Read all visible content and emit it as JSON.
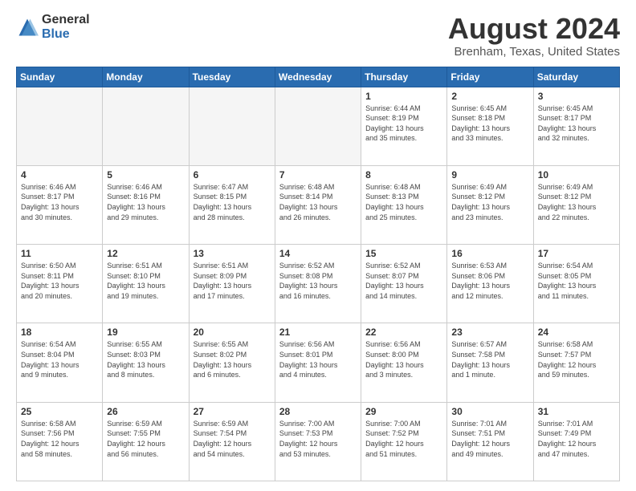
{
  "header": {
    "logo_general": "General",
    "logo_blue": "Blue",
    "title": "August 2024",
    "subtitle": "Brenham, Texas, United States"
  },
  "days_of_week": [
    "Sunday",
    "Monday",
    "Tuesday",
    "Wednesday",
    "Thursday",
    "Friday",
    "Saturday"
  ],
  "weeks": [
    [
      {
        "day": "",
        "info": "",
        "empty": true
      },
      {
        "day": "",
        "info": "",
        "empty": true
      },
      {
        "day": "",
        "info": "",
        "empty": true
      },
      {
        "day": "",
        "info": "",
        "empty": true
      },
      {
        "day": "1",
        "info": "Sunrise: 6:44 AM\nSunset: 8:19 PM\nDaylight: 13 hours\nand 35 minutes."
      },
      {
        "day": "2",
        "info": "Sunrise: 6:45 AM\nSunset: 8:18 PM\nDaylight: 13 hours\nand 33 minutes."
      },
      {
        "day": "3",
        "info": "Sunrise: 6:45 AM\nSunset: 8:17 PM\nDaylight: 13 hours\nand 32 minutes."
      }
    ],
    [
      {
        "day": "4",
        "info": "Sunrise: 6:46 AM\nSunset: 8:17 PM\nDaylight: 13 hours\nand 30 minutes."
      },
      {
        "day": "5",
        "info": "Sunrise: 6:46 AM\nSunset: 8:16 PM\nDaylight: 13 hours\nand 29 minutes."
      },
      {
        "day": "6",
        "info": "Sunrise: 6:47 AM\nSunset: 8:15 PM\nDaylight: 13 hours\nand 28 minutes."
      },
      {
        "day": "7",
        "info": "Sunrise: 6:48 AM\nSunset: 8:14 PM\nDaylight: 13 hours\nand 26 minutes."
      },
      {
        "day": "8",
        "info": "Sunrise: 6:48 AM\nSunset: 8:13 PM\nDaylight: 13 hours\nand 25 minutes."
      },
      {
        "day": "9",
        "info": "Sunrise: 6:49 AM\nSunset: 8:12 PM\nDaylight: 13 hours\nand 23 minutes."
      },
      {
        "day": "10",
        "info": "Sunrise: 6:49 AM\nSunset: 8:12 PM\nDaylight: 13 hours\nand 22 minutes."
      }
    ],
    [
      {
        "day": "11",
        "info": "Sunrise: 6:50 AM\nSunset: 8:11 PM\nDaylight: 13 hours\nand 20 minutes."
      },
      {
        "day": "12",
        "info": "Sunrise: 6:51 AM\nSunset: 8:10 PM\nDaylight: 13 hours\nand 19 minutes."
      },
      {
        "day": "13",
        "info": "Sunrise: 6:51 AM\nSunset: 8:09 PM\nDaylight: 13 hours\nand 17 minutes."
      },
      {
        "day": "14",
        "info": "Sunrise: 6:52 AM\nSunset: 8:08 PM\nDaylight: 13 hours\nand 16 minutes."
      },
      {
        "day": "15",
        "info": "Sunrise: 6:52 AM\nSunset: 8:07 PM\nDaylight: 13 hours\nand 14 minutes."
      },
      {
        "day": "16",
        "info": "Sunrise: 6:53 AM\nSunset: 8:06 PM\nDaylight: 13 hours\nand 12 minutes."
      },
      {
        "day": "17",
        "info": "Sunrise: 6:54 AM\nSunset: 8:05 PM\nDaylight: 13 hours\nand 11 minutes."
      }
    ],
    [
      {
        "day": "18",
        "info": "Sunrise: 6:54 AM\nSunset: 8:04 PM\nDaylight: 13 hours\nand 9 minutes."
      },
      {
        "day": "19",
        "info": "Sunrise: 6:55 AM\nSunset: 8:03 PM\nDaylight: 13 hours\nand 8 minutes."
      },
      {
        "day": "20",
        "info": "Sunrise: 6:55 AM\nSunset: 8:02 PM\nDaylight: 13 hours\nand 6 minutes."
      },
      {
        "day": "21",
        "info": "Sunrise: 6:56 AM\nSunset: 8:01 PM\nDaylight: 13 hours\nand 4 minutes."
      },
      {
        "day": "22",
        "info": "Sunrise: 6:56 AM\nSunset: 8:00 PM\nDaylight: 13 hours\nand 3 minutes."
      },
      {
        "day": "23",
        "info": "Sunrise: 6:57 AM\nSunset: 7:58 PM\nDaylight: 13 hours\nand 1 minute."
      },
      {
        "day": "24",
        "info": "Sunrise: 6:58 AM\nSunset: 7:57 PM\nDaylight: 12 hours\nand 59 minutes."
      }
    ],
    [
      {
        "day": "25",
        "info": "Sunrise: 6:58 AM\nSunset: 7:56 PM\nDaylight: 12 hours\nand 58 minutes."
      },
      {
        "day": "26",
        "info": "Sunrise: 6:59 AM\nSunset: 7:55 PM\nDaylight: 12 hours\nand 56 minutes."
      },
      {
        "day": "27",
        "info": "Sunrise: 6:59 AM\nSunset: 7:54 PM\nDaylight: 12 hours\nand 54 minutes."
      },
      {
        "day": "28",
        "info": "Sunrise: 7:00 AM\nSunset: 7:53 PM\nDaylight: 12 hours\nand 53 minutes."
      },
      {
        "day": "29",
        "info": "Sunrise: 7:00 AM\nSunset: 7:52 PM\nDaylight: 12 hours\nand 51 minutes."
      },
      {
        "day": "30",
        "info": "Sunrise: 7:01 AM\nSunset: 7:51 PM\nDaylight: 12 hours\nand 49 minutes."
      },
      {
        "day": "31",
        "info": "Sunrise: 7:01 AM\nSunset: 7:49 PM\nDaylight: 12 hours\nand 47 minutes."
      }
    ]
  ]
}
